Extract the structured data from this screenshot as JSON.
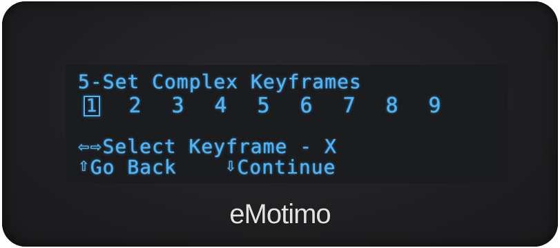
{
  "screen": {
    "title": "5-Set Complex Keyframes",
    "keyframes": [
      "1",
      "2",
      "3",
      "4",
      "5",
      "6",
      "7",
      "8",
      "9"
    ],
    "selected_keyframe": "1",
    "hint_select_arrows": "⇦⇨",
    "hint_select_text": "Select Keyframe - X",
    "hint_back_arrow": "⇧",
    "hint_back_text": "Go Back",
    "hint_continue_arrow": "⇩",
    "hint_continue_text": "Continue"
  },
  "device": {
    "brand": "eMotimo"
  },
  "colors": {
    "oled_text": "#47b6ff",
    "bezel": "#1f1f21",
    "brand_text": "#e2e2e2"
  }
}
